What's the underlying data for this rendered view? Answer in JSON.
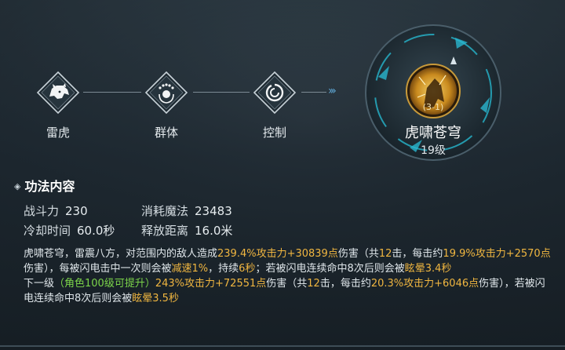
{
  "skill_tags": [
    {
      "icon": "tiger-icon",
      "label": "雷虎"
    },
    {
      "icon": "group-icon",
      "label": "群体"
    },
    {
      "icon": "swirl-icon",
      "label": "控制"
    }
  ],
  "skill": {
    "name": "虎啸苍穹",
    "level_text": "19级",
    "badge": "(3-1)"
  },
  "section_title": "功法内容",
  "stats": {
    "power_label": "战斗力",
    "power_value": "230",
    "mana_label": "消耗魔法",
    "mana_value": "23483",
    "cooldown_label": "冷却时间",
    "cooldown_value": "60.0秒",
    "range_label": "释放距离",
    "range_value": "16.0米"
  },
  "description": {
    "p1": "虎啸苍穹，雷震八方，对范围内的敌人造成",
    "h1": "239.4%攻击力+30839点",
    "p2": "伤害（共",
    "h2": "12",
    "p3": "击，每击约",
    "h3": "19.9%攻击力+2570点",
    "p4": "伤害），每被闪电击中一次则会被",
    "h4": "减速1%",
    "p5": "，持续",
    "h5": "6秒",
    "p6": "；若被闪电连续命中8次后则会被",
    "h6": "眩晕3.4秒"
  },
  "next_level": {
    "prefix": "下一级",
    "g1": "（角色100级可提升）",
    "h1": "243%攻击力+72551点",
    "p1": "伤害（共",
    "h2": "12",
    "p2": "击，每击约",
    "h3": "20.3%攻击力+6046点",
    "p3": "伤害），若被闪电连续命中8次后则会被",
    "h4": "眩晕3.5秒"
  },
  "colors": {
    "highlight": "#f0b640",
    "green": "#7bd44a",
    "arrow": "#5fa8d6"
  }
}
